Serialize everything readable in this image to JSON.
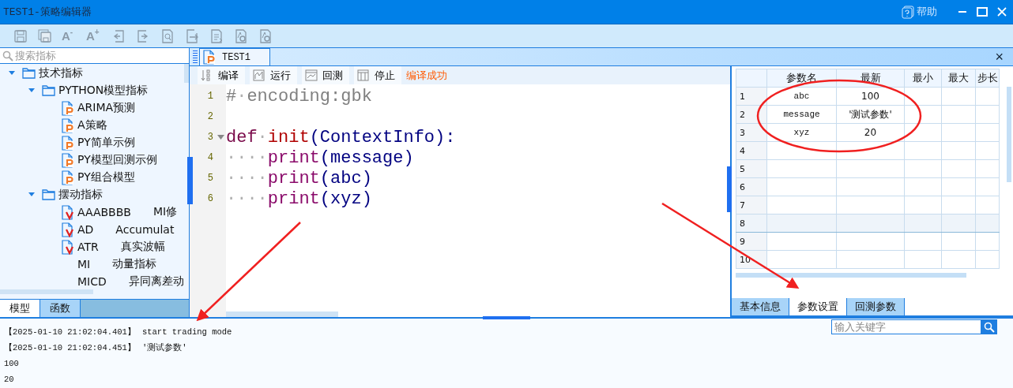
{
  "window": {
    "title": "TEST1-策略编辑器",
    "help": "帮助"
  },
  "toolbar": [
    {
      "kind": "save"
    },
    {
      "kind": "save-all"
    },
    {
      "kind": "font",
      "label": "A",
      "mark": "-"
    },
    {
      "kind": "font",
      "label": "A",
      "mark": "+"
    },
    {
      "kind": "undo"
    },
    {
      "kind": "redo"
    },
    {
      "kind": "find"
    },
    {
      "kind": "export"
    },
    {
      "kind": "import"
    },
    {
      "kind": "settings"
    },
    {
      "kind": "settings"
    }
  ],
  "sidebar": {
    "search": {
      "placeholder": "搜索指标"
    },
    "tree": [
      {
        "label": "技术指标",
        "kind": "folder",
        "expanded": true,
        "children": [
          {
            "label": "PYTHON模型指标",
            "kind": "folder",
            "expanded": true,
            "children": [
              {
                "label": "ARIMA预测",
                "kind": "py"
              },
              {
                "label": "A策略",
                "kind": "py"
              },
              {
                "label": "PY简单示例",
                "kind": "py"
              },
              {
                "label": "PY模型回测示例",
                "kind": "py"
              },
              {
                "label": "PY组合模型",
                "kind": "py"
              }
            ]
          },
          {
            "label": "摆动指标",
            "kind": "folder",
            "expanded": true,
            "children": [
              {
                "label": "AAABBBB",
                "desc": "MI修",
                "kind": "v"
              },
              {
                "label": "AD",
                "desc": "Accumulat",
                "kind": "v"
              },
              {
                "label": "ATR",
                "desc": "真实波幅",
                "kind": "v"
              },
              {
                "label": "MI",
                "desc": "动量指标",
                "kind": "plain"
              },
              {
                "label": "MICD",
                "desc": "异同离差动",
                "kind": "plain"
              }
            ]
          }
        ]
      }
    ],
    "tabs": [
      {
        "label": "模型",
        "selected": true
      },
      {
        "label": "函数",
        "selected": false
      }
    ]
  },
  "editor": {
    "tab": "TEST1",
    "close": "×",
    "actions": [
      {
        "kind": "compile",
        "label": "编译"
      },
      {
        "kind": "run",
        "label": "运行"
      },
      {
        "kind": "backtest",
        "label": "回测"
      },
      {
        "kind": "stop",
        "label": "停止"
      }
    ],
    "status": "编译成功",
    "lines": [
      {
        "number": "1",
        "tokens": [
          {
            "kind": "comment",
            "text": "#"
          },
          {
            "kind": "ws",
            "text": "·"
          },
          {
            "kind": "comment",
            "text": "encoding:gbk"
          }
        ]
      },
      {
        "number": "2"
      },
      {
        "number": "3",
        "fold": true,
        "tokens": [
          {
            "kind": "keyword",
            "text": "def"
          },
          {
            "kind": "ws",
            "text": "·"
          },
          {
            "kind": "func",
            "text": "init"
          },
          {
            "kind": "ident",
            "text": "(ContextInfo):"
          }
        ]
      },
      {
        "number": "4",
        "tokens": [
          {
            "kind": "ws",
            "text": "····"
          },
          {
            "kind": "builtin",
            "text": "print"
          },
          {
            "kind": "ident",
            "text": "(message)"
          }
        ]
      },
      {
        "number": "5",
        "tokens": [
          {
            "kind": "ws",
            "text": "····"
          },
          {
            "kind": "builtin",
            "text": "print"
          },
          {
            "kind": "ident",
            "text": "(abc)"
          }
        ]
      },
      {
        "number": "6",
        "tokens": [
          {
            "kind": "ws",
            "text": "····"
          },
          {
            "kind": "builtin",
            "text": "print"
          },
          {
            "kind": "ident",
            "text": "(xyz)"
          }
        ]
      }
    ]
  },
  "params": {
    "columns": [
      "参数名",
      "最新",
      "最小",
      "最大",
      "步长"
    ],
    "rows": [
      {
        "index": "1",
        "cells": [
          "abc",
          "100",
          "",
          "",
          ""
        ],
        "selected": false
      },
      {
        "index": "2",
        "cells": [
          "message",
          "'测试参数'",
          "",
          "",
          ""
        ],
        "selected": false
      },
      {
        "index": "3",
        "cells": [
          "xyz",
          "20",
          "",
          "",
          ""
        ],
        "selected": false
      },
      {
        "index": "4",
        "cells": [
          "",
          "",
          "",
          "",
          ""
        ],
        "selected": false
      },
      {
        "index": "5",
        "cells": [
          "",
          "",
          "",
          "",
          ""
        ],
        "selected": false
      },
      {
        "index": "6",
        "cells": [
          "",
          "",
          "",
          "",
          ""
        ],
        "selected": false
      },
      {
        "index": "7",
        "cells": [
          "",
          "",
          "",
          "",
          ""
        ],
        "selected": false
      },
      {
        "index": "8",
        "cells": [
          "",
          "",
          "",
          "",
          ""
        ],
        "selected": true
      },
      {
        "index": "9",
        "cells": [
          "",
          "",
          "",
          "",
          ""
        ],
        "selected": false
      },
      {
        "index": "10",
        "cells": [
          "",
          "",
          "",
          "",
          ""
        ],
        "selected": false
      }
    ],
    "tabs": [
      {
        "label": "基本信息",
        "selected": false
      },
      {
        "label": "参数设置",
        "selected": true
      },
      {
        "label": "回测参数",
        "selected": false
      }
    ]
  },
  "output": {
    "search": {
      "placeholder": "输入关键字"
    },
    "lines": [
      {
        "time": "【2025-01-10 21:02:04.401】",
        "text": "start trading mode"
      },
      {
        "time": "【2025-01-10 21:02:04.451】",
        "text": "'测试参数'"
      },
      {
        "text": "100"
      },
      {
        "text": "20"
      }
    ]
  }
}
